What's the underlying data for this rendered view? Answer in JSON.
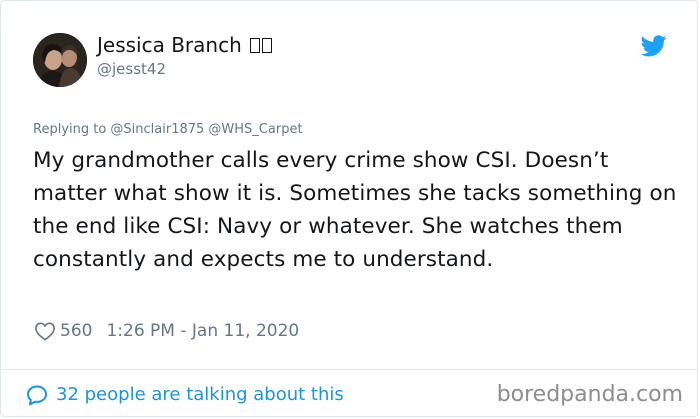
{
  "tweet": {
    "author": {
      "display_name": "Jessica Branch",
      "handle": "@jesst42"
    },
    "replying_to": "Replying to @Sinclair1875 @WHS_Carpet",
    "text": "My grandmother calls every crime show CSI. Doesn’t matter what show it is. Sometimes she tacks something on the end like CSI: Navy or whatever. She watches them constantly and expects me to understand.",
    "likes": "560",
    "timestamp": "1:26 PM - Jan 11, 2020",
    "conversation_link": "32 people are talking about this"
  },
  "watermark": "boredpanda.com",
  "icons": {
    "brand": "twitter-bird-icon",
    "like": "heart-icon",
    "conversation": "speech-bubble-icon"
  },
  "colors": {
    "link": "#1b95e0",
    "muted": "#657786",
    "text": "#14171a",
    "twitter_blue": "#1da1f2",
    "border": "#e1e8ed"
  }
}
